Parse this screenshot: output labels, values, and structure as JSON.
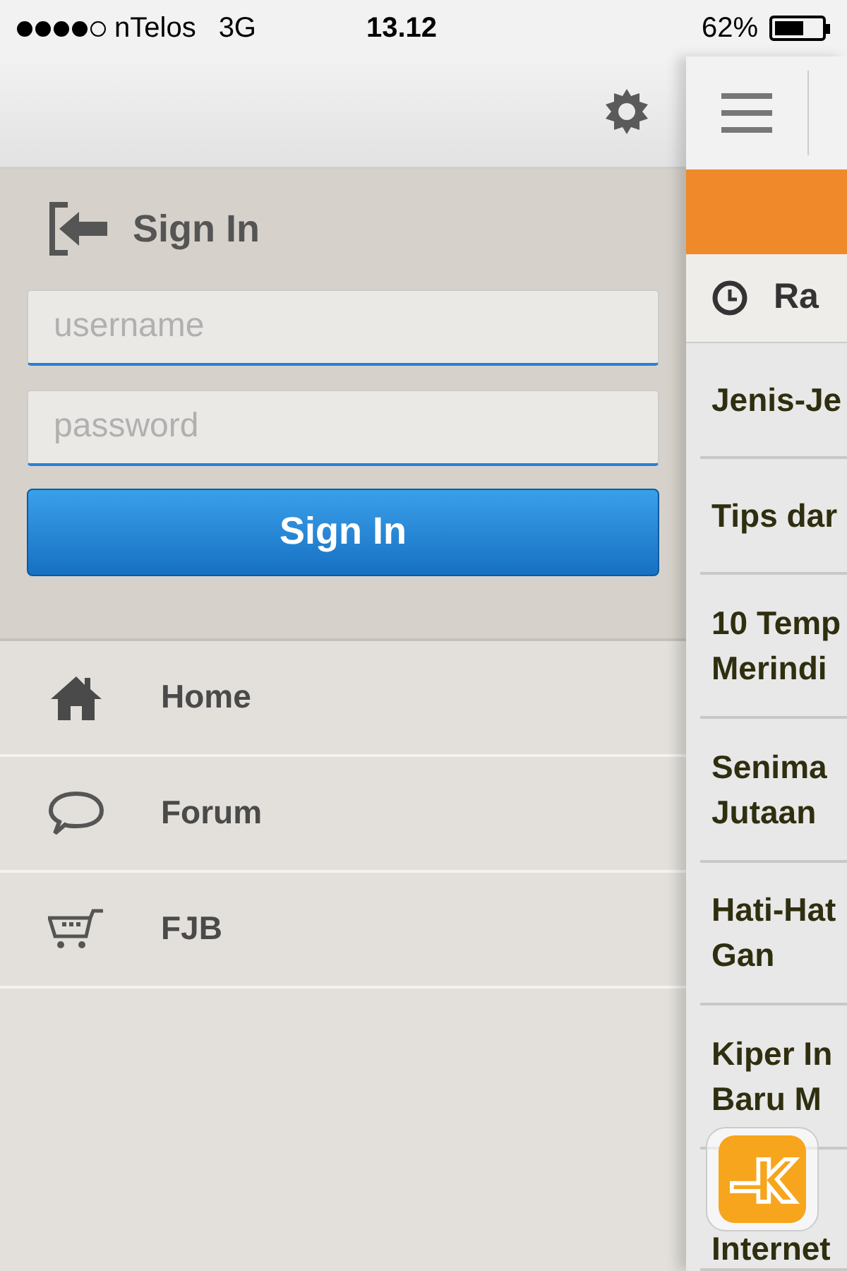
{
  "status_bar": {
    "carrier": "nTelos",
    "network": "3G",
    "time": "13.12",
    "battery": "62%",
    "level": 0.62
  },
  "sign_in": {
    "title": "Sign In",
    "username_placeholder": "username",
    "password_placeholder": "password",
    "button": "Sign In"
  },
  "menu": [
    {
      "kind": "home",
      "label": "Home"
    },
    {
      "kind": "forum",
      "label": "Forum"
    },
    {
      "kind": "cart",
      "label": "FJB"
    }
  ],
  "feed": {
    "header": "Ra",
    "articles": [
      {
        "lines": [
          "Jenis-Je"
        ]
      },
      {
        "lines": [
          "Tips dar"
        ]
      },
      {
        "lines": [
          "10 Temp",
          "Merindi"
        ]
      },
      {
        "lines": [
          "Senima",
          "Jutaan"
        ]
      },
      {
        "lines": [
          "Hati-Hat",
          "Gan"
        ]
      },
      {
        "lines": [
          "Kiper In",
          "Baru M"
        ]
      },
      {
        "lines": [
          "Internet"
        ]
      }
    ]
  }
}
